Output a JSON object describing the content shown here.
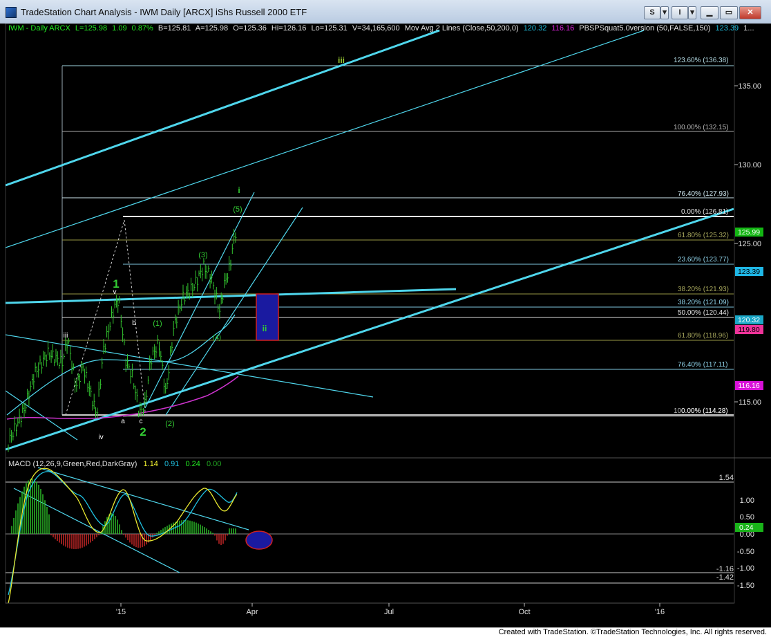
{
  "window": {
    "title": "TradeStation Chart Analysis - IWM Daily [ARCX] iShs Russell 2000 ETF",
    "buttons": {
      "s": "S",
      "i": "I"
    }
  },
  "price_header": {
    "symbol": "IWM - Daily  ARCX",
    "last": "L=125.98",
    "change": "1.09",
    "change_pct": "0.87%",
    "bid": "B=125.81",
    "ask": "A=125.98",
    "open": "O=125.36",
    "high": "Hi=126.16",
    "low": "Lo=125.31",
    "volume": "V=34,165,600",
    "ma_label": "Mov Avg 2 Lines (Close,50,200,0)",
    "ma_fast": "120.32",
    "ma_slow": "116.16",
    "indicator_label": "PBSPSquat5.0version (50,FALSE,150)",
    "indicator_value": "123.39",
    "trail": "1..."
  },
  "macd_header": {
    "label": "MACD (12,26,9,Green,Red,DarkGray)",
    "macd": "1.14",
    "signal": "0.91",
    "diff": "0.24",
    "zero": "0.00"
  },
  "price_axis": {
    "ticks": [
      "135.00",
      "130.00",
      "125.00",
      "115.00"
    ],
    "badges": [
      {
        "text": "125.99",
        "color": "#13b613",
        "text_color": "#ffffff"
      },
      {
        "text": "123.39",
        "color": "#1fb7e6",
        "text_color": "#000000"
      },
      {
        "text": "120.32",
        "color": "#1aa7c7",
        "text_color": "#ffffff"
      },
      {
        "text": "119.80",
        "color": "#ee3399",
        "text_color": "#000000"
      },
      {
        "text": "116.16",
        "color": "#d811d8",
        "text_color": "#ffffff"
      }
    ]
  },
  "macd_axis": {
    "ticks": [
      "1.54",
      "1.00",
      "0.50",
      "0.00",
      "-0.50",
      "-1.00",
      "-1.16",
      "-1.42",
      "-1.50"
    ],
    "badge": {
      "text": "0.24",
      "color": "#19b319"
    }
  },
  "date_axis": {
    "labels": [
      "'15",
      "Apr",
      "Jul",
      "Oct",
      "'16"
    ]
  },
  "fib_levels": [
    {
      "text": "123.60% (136.38)",
      "color": "#b7dfe8"
    },
    {
      "text": "100.00% (132.15)",
      "color": "#b8b8b8"
    },
    {
      "text": "76.40% (127.93)",
      "color": "#cfe8f0"
    },
    {
      "text": "0.00% (126.81)",
      "color": "#e6e6e6"
    },
    {
      "text": "61.80% (125.32)",
      "color": "#a6a65c"
    },
    {
      "text": "23.60% (123.77)",
      "color": "#8fd2e8"
    },
    {
      "text": "38.20% (121.93)",
      "color": "#a6a65c"
    },
    {
      "text": "38.20% (121.09)",
      "color": "#8fd2e8"
    },
    {
      "text": "50.00% (120.44)",
      "color": "#e6e6e6"
    },
    {
      "text": "61.80% (118.96)",
      "color": "#a6a65c"
    },
    {
      "text": "76.40% (117.11)",
      "color": "#8fd2e8"
    },
    {
      "text": "100.00% (114.28)",
      "color": "#b8b8b8"
    },
    {
      "text": "0.00% (114.28)",
      "color": "#e6e6e6"
    }
  ],
  "wave_labels": [
    {
      "text": "iii",
      "color": "#9acd32"
    },
    {
      "text": "i",
      "color": "#33cc33"
    },
    {
      "text": "(5)",
      "color": "#33cc33"
    },
    {
      "text": "(3)",
      "color": "#33cc33"
    },
    {
      "text": "1",
      "color": "#33cc33"
    },
    {
      "text": "v",
      "color": "#ffffff"
    },
    {
      "text": "b",
      "color": "#ffffff"
    },
    {
      "text": "(1)",
      "color": "#33cc33"
    },
    {
      "text": "ii",
      "color": "#33cc33"
    },
    {
      "text": "(4)",
      "color": "#33cc33"
    },
    {
      "text": "iii",
      "color": "#ffffff"
    },
    {
      "text": "iv",
      "color": "#ffffff"
    },
    {
      "text": "a",
      "color": "#ffffff"
    },
    {
      "text": "c",
      "color": "#ffffff"
    },
    {
      "text": "2",
      "color": "#33cc33"
    },
    {
      "text": "(2)",
      "color": "#33cc33"
    }
  ],
  "footer": {
    "text": "Created with TradeStation. ©TradeStation Technologies, Inc. All rights reserved."
  }
}
